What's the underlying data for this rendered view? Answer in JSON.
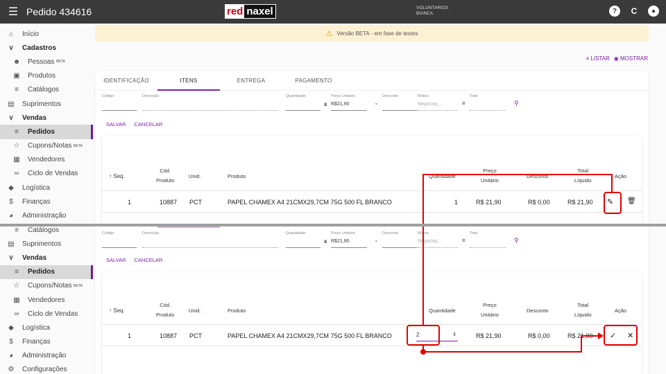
{
  "topbar": {
    "menu_icon": "menu-icon",
    "title": "Pedido 434616",
    "logo_red": "red",
    "logo_naxel": "naxel",
    "user_line1": "VOLUNTARIOS",
    "user_line2": "BIANCA",
    "help_icon": "?",
    "refresh_icon": "C",
    "account_icon": "●"
  },
  "banner": {
    "text": "Versão BETA - em fase de testes"
  },
  "listbar": {
    "listar": "LISTAR",
    "mostrar": "MOSTRAR"
  },
  "sidebar_top": [
    {
      "label": "Início",
      "icon": "⌂"
    },
    {
      "label": "Cadastros",
      "icon": "∨"
    },
    {
      "label": "Pessoas",
      "beta": "BETA",
      "icon": "☺"
    },
    {
      "label": "Produtos",
      "icon": "▣"
    },
    {
      "label": "Catálogos",
      "icon": "≡"
    },
    {
      "label": "Suprimentos",
      "icon": "▤"
    },
    {
      "label": "Vendas",
      "icon": "∨"
    },
    {
      "label": "Pedidos",
      "icon": "≡"
    },
    {
      "label": "Cupons/Notas",
      "beta": "BETA",
      "icon": "☆"
    },
    {
      "label": "Vendedores",
      "icon": "▦"
    },
    {
      "label": "Ciclo de Vendas",
      "icon": "∞"
    },
    {
      "label": "Logística",
      "icon": "◆"
    },
    {
      "label": "Finanças",
      "icon": "$"
    },
    {
      "label": "Administração",
      "icon": "◕"
    }
  ],
  "sidebar_bottom": [
    {
      "label": "Catálogos",
      "icon": "≡"
    },
    {
      "label": "Suprimentos",
      "icon": "▤"
    },
    {
      "label": "Vendas",
      "icon": "∨"
    },
    {
      "label": "Pedidos",
      "icon": "≡"
    },
    {
      "label": "Cupons/Notas",
      "beta": "BETA",
      "icon": "☆"
    },
    {
      "label": "Vendedores",
      "icon": "▦"
    },
    {
      "label": "Ciclo de Vendas",
      "icon": "∞"
    },
    {
      "label": "Logística",
      "icon": "◆"
    },
    {
      "label": "Finanças",
      "icon": "$"
    },
    {
      "label": "Administração",
      "icon": "◕"
    },
    {
      "label": "Configurações",
      "icon": "⚙"
    }
  ],
  "tabs": [
    "IDENTIFICAÇÃO",
    "ITENS",
    "ENTREGA",
    "PAGAMENTO"
  ],
  "form": {
    "codigo": "Código",
    "descricao": "Descrição",
    "quantidade": "Quantidade",
    "preco_unitario": "Preço Unitário",
    "preco_value": "R$21,90",
    "desconto": "Desconto",
    "motivo": "Motivo",
    "motivo_value": "Negociaç...",
    "total": "Total",
    "op_mult": "x",
    "op_minus": "-",
    "op_eq": "="
  },
  "actions": {
    "salvar": "SALVAR",
    "cancelar": "CANCELAR"
  },
  "table": {
    "headers": {
      "seq": "Seq.",
      "cod1": "Cód.",
      "cod2": "Produto",
      "unid": "Unid.",
      "produto": "Produto",
      "quantidade": "Quantidade",
      "preco1": "Preço",
      "preco2": "Unitário",
      "desconto": "Desconto",
      "total1": "Total",
      "total2": "Líquido",
      "acao": "Ação"
    },
    "row": {
      "seq": "1",
      "cod": "10887",
      "unid": "PCT",
      "produto": "PAPEL CHAMEX A4 21CMX29,7CM 75G 500 FL BRANCO",
      "quantidade": "1",
      "preco": "R$ 21,90",
      "desconto": "R$ 0,00",
      "total": "R$ 21,90"
    },
    "edit_quantity": "2"
  },
  "colors": {
    "accent": "#7b1fa2",
    "annotation": "#e00000",
    "topbar": "#3a3a3a"
  }
}
